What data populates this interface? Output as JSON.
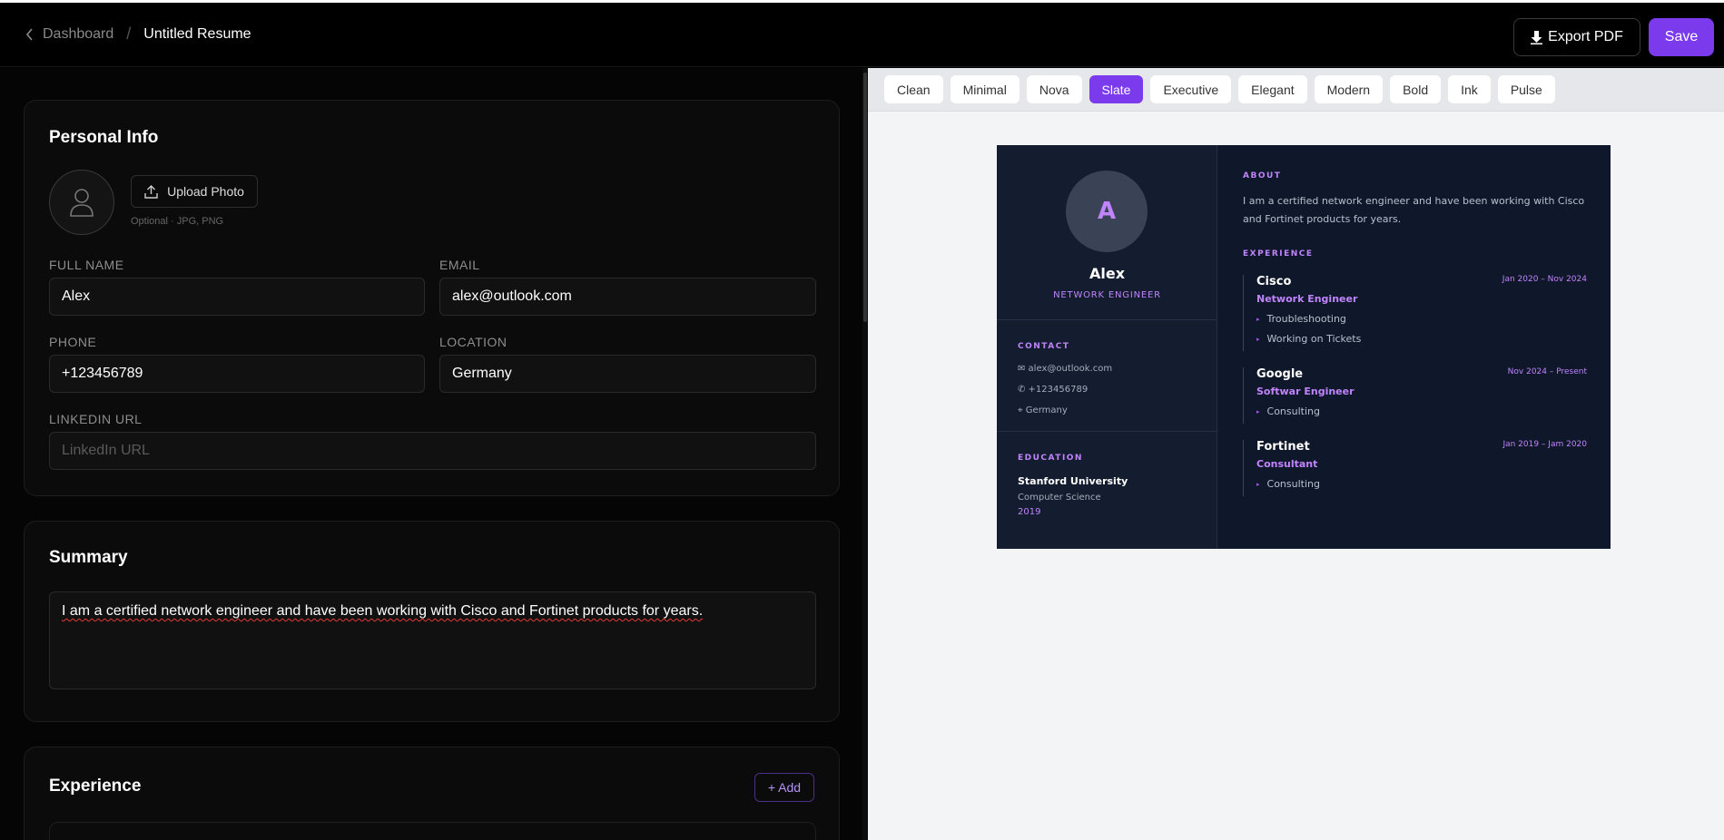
{
  "header": {
    "breadcrumb_back": "Dashboard",
    "breadcrumb_sep": "/",
    "title": "Untitled Resume",
    "export_label": "Export PDF",
    "save_label": "Save"
  },
  "personal": {
    "heading": "Personal Info",
    "upload_label": "Upload Photo",
    "upload_hint": "Optional · JPG, PNG",
    "fullname_label": "FULL NAME",
    "fullname_value": "Alex",
    "email_label": "EMAIL",
    "email_value": "alex@outlook.com",
    "phone_label": "PHONE",
    "phone_value": "+123456789",
    "location_label": "LOCATION",
    "location_value": "Germany",
    "linkedin_label": "LINKEDIN URL",
    "linkedin_placeholder": "LinkedIn URL"
  },
  "summary": {
    "heading": "Summary",
    "value": "I am a certified network engineer and have been working with Cisco and Fortinet products for years."
  },
  "experience": {
    "heading": "Experience",
    "add_label": "+ Add"
  },
  "templates": {
    "items": [
      "Clean",
      "Minimal",
      "Nova",
      "Slate",
      "Executive",
      "Elegant",
      "Modern",
      "Bold",
      "Ink",
      "Pulse"
    ],
    "active": "Slate"
  },
  "preview": {
    "initial": "A",
    "name": "Alex",
    "title": "NETWORK ENGINEER",
    "contact_heading": "CONTACT",
    "contact_email": "✉ alex@outlook.com",
    "contact_phone": "✆ +123456789",
    "contact_location": "⌖ Germany",
    "education_heading": "EDUCATION",
    "edu_school": "Stanford University",
    "edu_degree": "Computer Science",
    "edu_year": "2019",
    "about_heading": "ABOUT",
    "about_text": "I am a certified network engineer and have been working with Cisco and Fortinet products for years.",
    "experience_heading": "EXPERIENCE",
    "jobs": [
      {
        "company": "Cisco",
        "dates": "Jan 2020 – Nov 2024",
        "role": "Network Engineer",
        "bullets": [
          "Troubleshooting",
          "Working on Tickets"
        ]
      },
      {
        "company": "Google",
        "dates": "Nov 2024 – Present",
        "role": "Softwar Engineer",
        "bullets": [
          "Consulting"
        ]
      },
      {
        "company": "Fortinet",
        "dates": "Jan 2019 – Jam 2020",
        "role": "Consultant",
        "bullets": [
          "Consulting"
        ]
      }
    ]
  },
  "colors": {
    "accent": "#7c3aed",
    "resume_accent": "#c084fc",
    "resume_bg": "#0f172a"
  }
}
